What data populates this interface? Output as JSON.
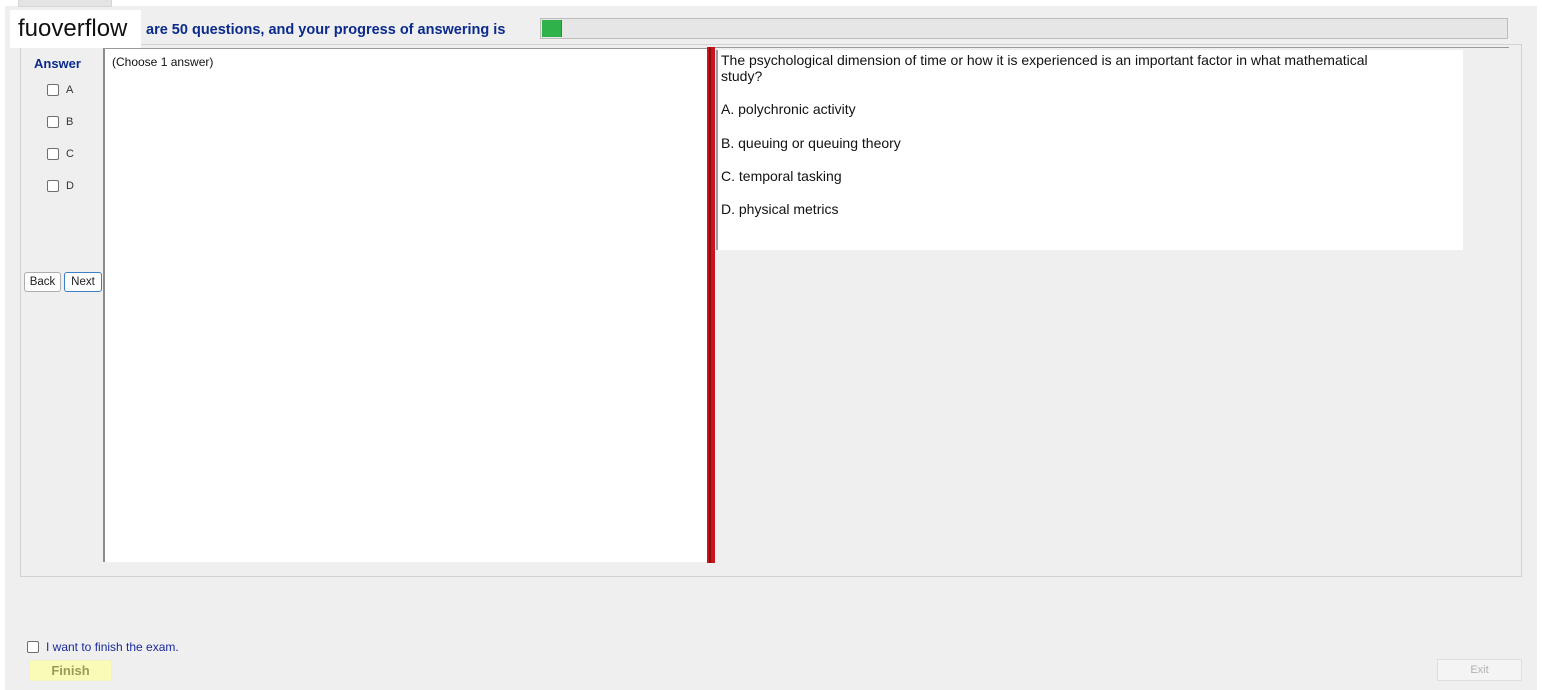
{
  "watermark": {
    "text": "fuoverflow"
  },
  "header": {
    "progress_text": "are 50 questions, and your progress of answering is",
    "progress_fraction": 0.02
  },
  "answer_panel": {
    "title": "Answer",
    "options": [
      "A",
      "B",
      "C",
      "D"
    ]
  },
  "nav": {
    "back_label": "Back",
    "next_label": "Next"
  },
  "left_pane": {
    "instruction": "(Choose 1 answer)"
  },
  "question": {
    "text": "The psychological dimension of time or how it is experienced is an important factor in what mathematical study?",
    "options": [
      "A.  polychronic activity",
      "B.  queuing or queuing theory",
      "C.  temporal tasking",
      "D.  physical metrics"
    ]
  },
  "footer": {
    "finish_check_label": "I want to finish the exam.",
    "finish_label": "Finish",
    "exit_label": "Exit"
  },
  "colors": {
    "header_text": "#0b2b8c",
    "progress_green": "#2fb24a",
    "splitter_red": "#c9151b",
    "finish_bg": "#fbfbb8"
  }
}
